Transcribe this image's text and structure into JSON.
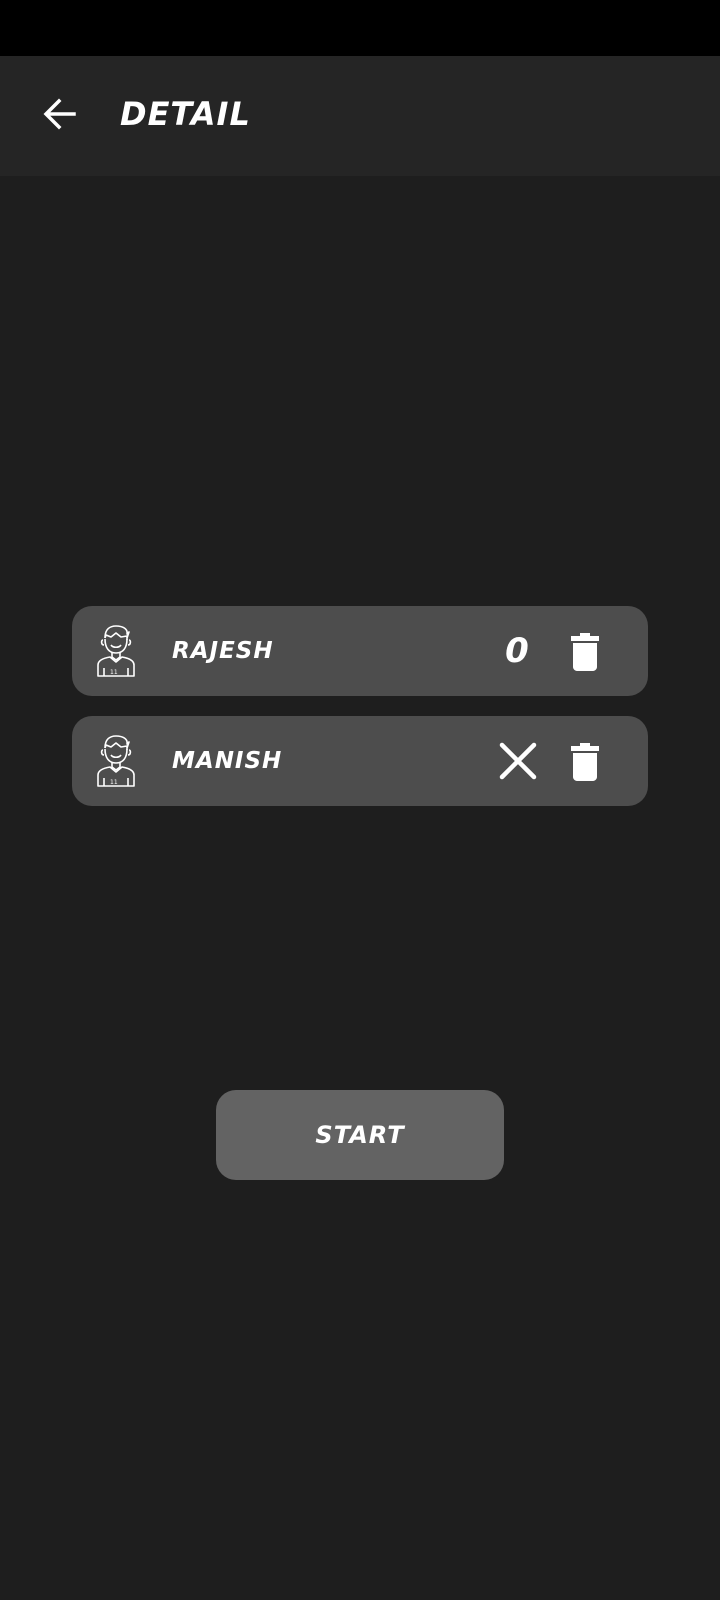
{
  "app_bar": {
    "title": "DETAIL",
    "back_icon": "arrow-left-icon"
  },
  "players": [
    {
      "name": "RAJESH",
      "score": "0",
      "action_icon": "trash-icon",
      "avatar_icon": "player-avatar-icon"
    },
    {
      "name": "MANISH",
      "score": "",
      "status_icon": "close-icon",
      "action_icon": "trash-icon",
      "avatar_icon": "player-avatar-icon"
    }
  ],
  "start_button": {
    "label": "START"
  },
  "colors": {
    "background": "#1e1e1e",
    "app_bar": "#252525",
    "card": "#4d4d4d",
    "start_button": "#636363",
    "text": "#ffffff"
  }
}
